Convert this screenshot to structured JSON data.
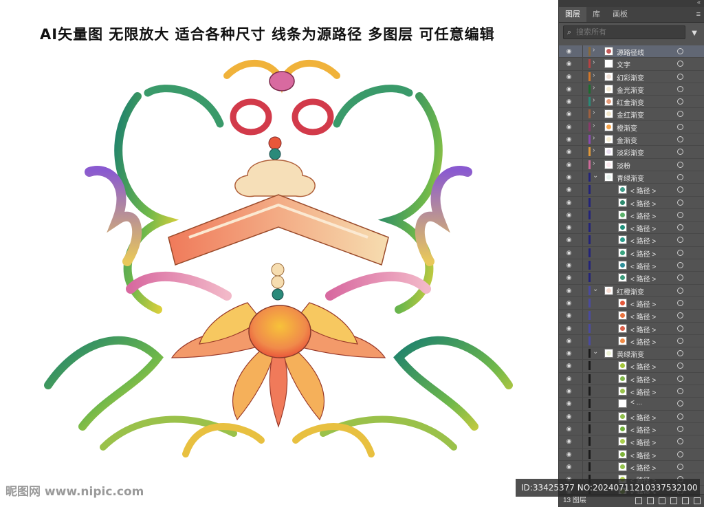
{
  "artboard": {
    "headline": "AI矢量图  无限放大 适合各种尺寸  线条为源路径  多图层 可任意编辑",
    "watermark": "昵图网 www.nipic.com",
    "id_bar": "ID:33425377 NO:20240711210337532100"
  },
  "panel": {
    "tabs": [
      {
        "label": "图层",
        "active": true
      },
      {
        "label": "库",
        "active": false
      },
      {
        "label": "画板",
        "active": false
      }
    ],
    "search_placeholder": "搜索所有",
    "footer_count": "13 图层",
    "layers": [
      {
        "label": "源路径线",
        "indent": 0,
        "twirl": "›",
        "color": "#8a6a3a",
        "thumb": "#c45a5a",
        "selected": true
      },
      {
        "label": "文字",
        "indent": 0,
        "twirl": "›",
        "color": "#b84242",
        "thumb": "#ffffff"
      },
      {
        "label": "幻彩渐变",
        "indent": 0,
        "twirl": "›",
        "color": "#d4782a",
        "thumb": "#f1e1d6"
      },
      {
        "label": "金光渐变",
        "indent": 0,
        "twirl": "›",
        "color": "#1c6d2e",
        "thumb": "#f4ead2"
      },
      {
        "label": "红金渐变",
        "indent": 0,
        "twirl": "›",
        "color": "#2a8a78",
        "thumb": "#e59b7a"
      },
      {
        "label": "金红渐变",
        "indent": 0,
        "twirl": "›",
        "color": "#a06040",
        "thumb": "#f3e6c9"
      },
      {
        "label": "橙渐变",
        "indent": 0,
        "twirl": "›",
        "color": "#8a3a6a",
        "thumb": "#f5a34a"
      },
      {
        "label": "金渐变",
        "indent": 0,
        "twirl": "›",
        "color": "#8a4ab0",
        "thumb": "#f7eed2"
      },
      {
        "label": "淡彩渐变",
        "indent": 0,
        "twirl": "›",
        "color": "#e39a3a",
        "thumb": "#eadff0"
      },
      {
        "label": "淡粉",
        "indent": 0,
        "twirl": "›",
        "color": "#d06a9a",
        "thumb": "#fbe9ee"
      },
      {
        "label": "青绿渐变",
        "indent": 0,
        "twirl": "⌄",
        "color": "#23237a",
        "thumb": "#e9f3ee"
      },
      {
        "label": "< 路径 >",
        "indent": 1,
        "twirl": "",
        "color": "#23237a",
        "thumb": "#3e9b88"
      },
      {
        "label": "< 路径 >",
        "indent": 1,
        "twirl": "",
        "color": "#23237a",
        "thumb": "#2e8a6e"
      },
      {
        "label": "< 路径 >",
        "indent": 1,
        "twirl": "",
        "color": "#23237a",
        "thumb": "#5ab16a"
      },
      {
        "label": "< 路径 >",
        "indent": 1,
        "twirl": "",
        "color": "#23237a",
        "thumb": "#1f8f7a"
      },
      {
        "label": "< 路径 >",
        "indent": 1,
        "twirl": "",
        "color": "#23237a",
        "thumb": "#2a9a8a"
      },
      {
        "label": "< 路径 >",
        "indent": 1,
        "twirl": "",
        "color": "#23237a",
        "thumb": "#3aa37f"
      },
      {
        "label": "< 路径 >",
        "indent": 1,
        "twirl": "",
        "color": "#23237a",
        "thumb": "#2f8f9a"
      },
      {
        "label": "< 路径 >",
        "indent": 1,
        "twirl": "",
        "color": "#23237a",
        "thumb": "#3a9a7a"
      },
      {
        "label": "红橙渐变",
        "indent": 0,
        "twirl": "⌄",
        "color": "#4a4aa0",
        "thumb": "#f7dcd2"
      },
      {
        "label": "< 路径 >",
        "indent": 1,
        "twirl": "",
        "color": "#4a4aa0",
        "thumb": "#e3573a"
      },
      {
        "label": "< 路径 >",
        "indent": 1,
        "twirl": "",
        "color": "#4a4aa0",
        "thumb": "#e8733f"
      },
      {
        "label": "< 路径 >",
        "indent": 1,
        "twirl": "",
        "color": "#4a4aa0",
        "thumb": "#d9604a"
      },
      {
        "label": "< 路径 >",
        "indent": 1,
        "twirl": "",
        "color": "#4a4aa0",
        "thumb": "#ef8a45"
      },
      {
        "label": "黄绿渐变",
        "indent": 0,
        "twirl": "⌄",
        "color": "#1a1a1a",
        "thumb": "#eef3d6"
      },
      {
        "label": "< 路径 >",
        "indent": 1,
        "twirl": "",
        "color": "#1a1a1a",
        "thumb": "#a4c63a"
      },
      {
        "label": "< 路径 >",
        "indent": 1,
        "twirl": "",
        "color": "#1a1a1a",
        "thumb": "#7fb54a"
      },
      {
        "label": "< 路径 >",
        "indent": 1,
        "twirl": "",
        "color": "#1a1a1a",
        "thumb": "#98c14a"
      },
      {
        "label": "< ...",
        "indent": 1,
        "twirl": "",
        "color": "#1a1a1a",
        "thumb": "#ffffff"
      },
      {
        "label": "< 路径 >",
        "indent": 1,
        "twirl": "",
        "color": "#1a1a1a",
        "thumb": "#8fbe4a"
      },
      {
        "label": "< 路径 >",
        "indent": 1,
        "twirl": "",
        "color": "#1a1a1a",
        "thumb": "#6fae3a"
      },
      {
        "label": "< 路径 >",
        "indent": 1,
        "twirl": "",
        "color": "#1a1a1a",
        "thumb": "#a8cc4a"
      },
      {
        "label": "< 路径 >",
        "indent": 1,
        "twirl": "",
        "color": "#1a1a1a",
        "thumb": "#7db23a"
      },
      {
        "label": "< 路径 >",
        "indent": 1,
        "twirl": "",
        "color": "#1a1a1a",
        "thumb": "#94c24c"
      },
      {
        "label": "< 路径 >",
        "indent": 1,
        "twirl": "",
        "color": "#1a1a1a",
        "thumb": "#b0d04e"
      },
      {
        "label": "< 路径 >",
        "indent": 1,
        "twirl": "",
        "color": "#1a1a1a",
        "thumb": "#86b840"
      },
      {
        "label": "< 路径 >",
        "indent": 1,
        "twirl": "",
        "color": "#1a1a1a",
        "thumb": "#9cc64a"
      }
    ]
  }
}
